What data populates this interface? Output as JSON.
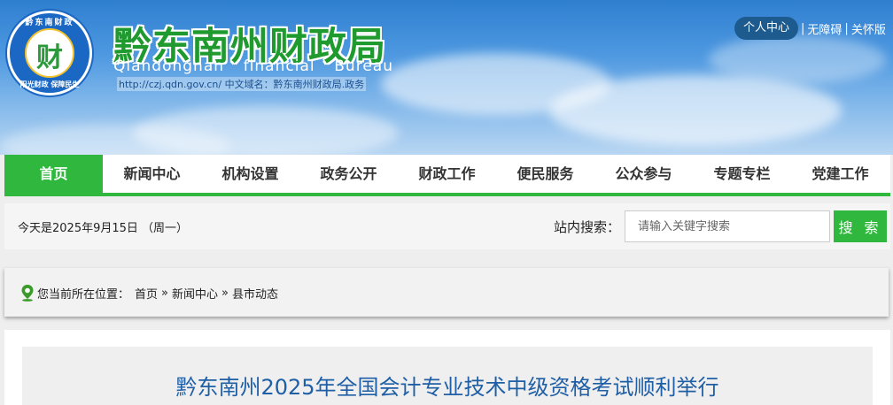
{
  "header": {
    "seal": {
      "char": "财",
      "top_text": "黔东南财政",
      "bottom_text": "阳光财政 保障民生"
    },
    "title": "黔东南州财政局",
    "subtitle_words": [
      "Qiandongnan",
      "financial",
      "Bureau"
    ],
    "url_line": "http://czj.qdn.gov.cn/ 中文域名：黔东南州财政局.政务",
    "top_links": {
      "personal": "个人中心",
      "sep": "|",
      "accessibility": "无障碍",
      "classic": "关怀版"
    }
  },
  "nav": {
    "items": [
      "首页",
      "新闻中心",
      "机构设置",
      "政务公开",
      "财政工作",
      "便民服务",
      "公众参与",
      "专题专栏",
      "党建工作"
    ],
    "active_index": 0
  },
  "bar": {
    "date": "今天是2025年9月15日 （周一）",
    "search_label": "站内搜索：",
    "search_placeholder": "请输入关键字搜索",
    "search_button": "搜 索"
  },
  "breadcrumb": {
    "prefix": "您当前所在位置：",
    "sep": "»",
    "items": [
      "首页",
      "新闻中心",
      "县市动态"
    ]
  },
  "article": {
    "title": "黔东南州2025年全国会计专业技术中级资格考试顺利举行"
  },
  "colors": {
    "accent_green": "#2fb83d",
    "title_blue": "#1f5fa6",
    "personal_btn": "#1d5b8e"
  }
}
